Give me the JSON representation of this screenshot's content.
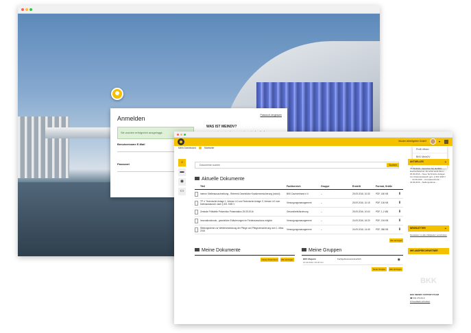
{
  "login": {
    "title": "Anmelden",
    "success": "Sie wurden erfolgreich ausgeloggt.",
    "username_label": "Benutzername E-Mail",
    "password_label": "Passwort",
    "forgot_link": "Passwort vergessen",
    "info_heading": "WAS IST MEINDV?",
    "info_text": "BKK MeinDV ist Ihre zentrale Anlaufstelle für",
    "login_button": "Anmelden"
  },
  "header": {
    "company": "Muster Arbeitgeber GmbH",
    "caret": "▾"
  },
  "breadcrumb": [
    "Mein Dashboard",
    "Startseite"
  ],
  "user_menu": [
    "Profil öffnen",
    "BKK MeinDV",
    "Abmelden"
  ],
  "nav_icons": [
    "home-icon",
    "folder-icon",
    "eye-icon",
    "chat-icon"
  ],
  "search": {
    "placeholder": "Dokumente suchen",
    "button": "Suchen"
  },
  "aktuelle": {
    "title": "Aktuelle Dokumente",
    "columns": [
      "Titel",
      "Fachbereich",
      "Gruppe",
      "Erstellt",
      "Format, Größe"
    ],
    "rows": [
      {
        "title": "Interne Stellenausschreibung - Referent Gesetzliche Krankenversicherung (m/w/d)",
        "cat": "BKK Dachverband e.V.",
        "grp": "–",
        "date": "25.09.2016, 10:30",
        "fmt": "PDF, 180 KB"
      },
      {
        "title": "TP 4: Technische Anlage 1, Version 4.0 und Technische Anlage 3, Version 4.0 zum Datenaustausch nach § 301 SGB V",
        "cat": "Versorgungsmanagement",
        "grp": "–",
        "date": "25.09.2016, 10:15",
        "fmt": "PDF, 106 KB"
      },
      {
        "title": "Zentrale Prüfstelle Prävention Präsentation 25.09.2016",
        "cat": "Gesundheitsförderung",
        "grp": "–",
        "date": "25.09.2016, 10:04",
        "fmt": "PDF, 1,1 MB"
      },
      {
        "title": "Innovationsfonds - gesetzliche Erläuterungen im Förderausschuss möglich",
        "cat": "Versorgungsmanagement",
        "grp": "–",
        "date": "24.09.2016, 16:20",
        "fmt": "PDF, 194 KB"
      },
      {
        "title": "Stellungnahme zur Weiterentwicklung der Pflege und Pflegeversicherung vom 1. März 2016",
        "cat": "Versorgungsmanagement",
        "grp": "–",
        "date": "24.09.2016, 14:45",
        "fmt": "PDF, 386 KB"
      }
    ],
    "all_button": "Alle anzeigen"
  },
  "meine_dokumente": {
    "title": "Meine Dokumente",
    "buttons": [
      "Neues Dokument",
      "Alle anzeigen"
    ]
  },
  "meine_gruppen": {
    "title": "Meine Gruppen",
    "group_name": "BKK Magazin",
    "group_meta": "10.09.2016, 09:45 Uhr",
    "group_status": "Fachgebietsverantwortlich",
    "buttons": [
      "Neue Gruppe",
      "Alle anzeigen"
    ]
  },
  "sidebar": {
    "aktuelles": {
      "title": "AKTUELLES",
      "text": "26.09.2016 – Sprechen Sie die BKK Dachverband an. Ab sofort steht Ihnen ... 25.09.2016 – Neue Technische Anlagen zum Datenaustausch gem. § 301 SGB V ... 24.09.2016 – Innovationsfonds ... 23.09.2016 – Stellungnahme ..."
    },
    "newsletter": {
      "title": "NEWSLETTER",
      "text": "Newsletter zu allen Mitglieder verschicken"
    },
    "ansprechpartner": {
      "title": "IHR ANSPRECHPARTNER"
    },
    "support": {
      "title": "BKK MEINDV SUPPORT-TEAM",
      "phone": "030 270 06-0",
      "mail": "Feedback schreiben"
    },
    "watermark": "BKK"
  },
  "colors": {
    "accent": "#f5c000",
    "text": "#222222"
  }
}
